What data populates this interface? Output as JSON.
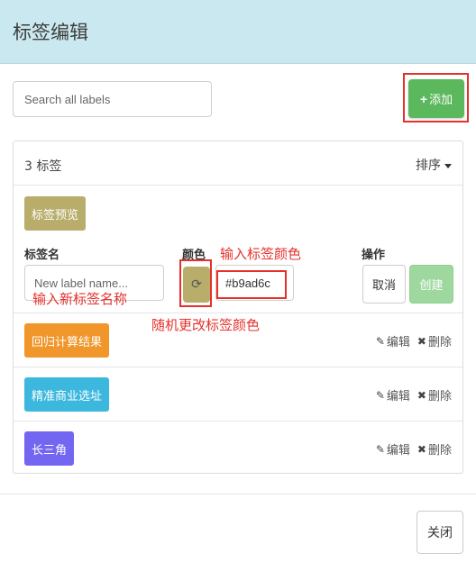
{
  "dialog": {
    "title": "标签编辑"
  },
  "search": {
    "placeholder": "Search all labels"
  },
  "add_button": {
    "icon": "plus-icon",
    "label": "添加"
  },
  "panel": {
    "count_label": "3 标签",
    "sort_label": "排序"
  },
  "preview": {
    "label": "标签预览",
    "color": "#b9ad6c"
  },
  "form": {
    "name_label": "标签名",
    "name_placeholder": "New label name...",
    "color_label": "颜色",
    "color_value": "#b9ad6c",
    "actions_label": "操作",
    "cancel_label": "取消",
    "create_label": "创建"
  },
  "annotations": {
    "input_color": "输入标签颜色",
    "input_name": "输入新标签名称",
    "random_color": "随机更改标签颜色"
  },
  "labels": [
    {
      "name": "回归计算结果",
      "color": "#f0962a"
    },
    {
      "name": "精准商业选址",
      "color": "#3cb8de"
    },
    {
      "name": "长三角",
      "color": "#7366f0"
    }
  ],
  "row_actions": {
    "edit_label": "编辑",
    "delete_label": "删除"
  },
  "footer": {
    "close_label": "关闭"
  }
}
